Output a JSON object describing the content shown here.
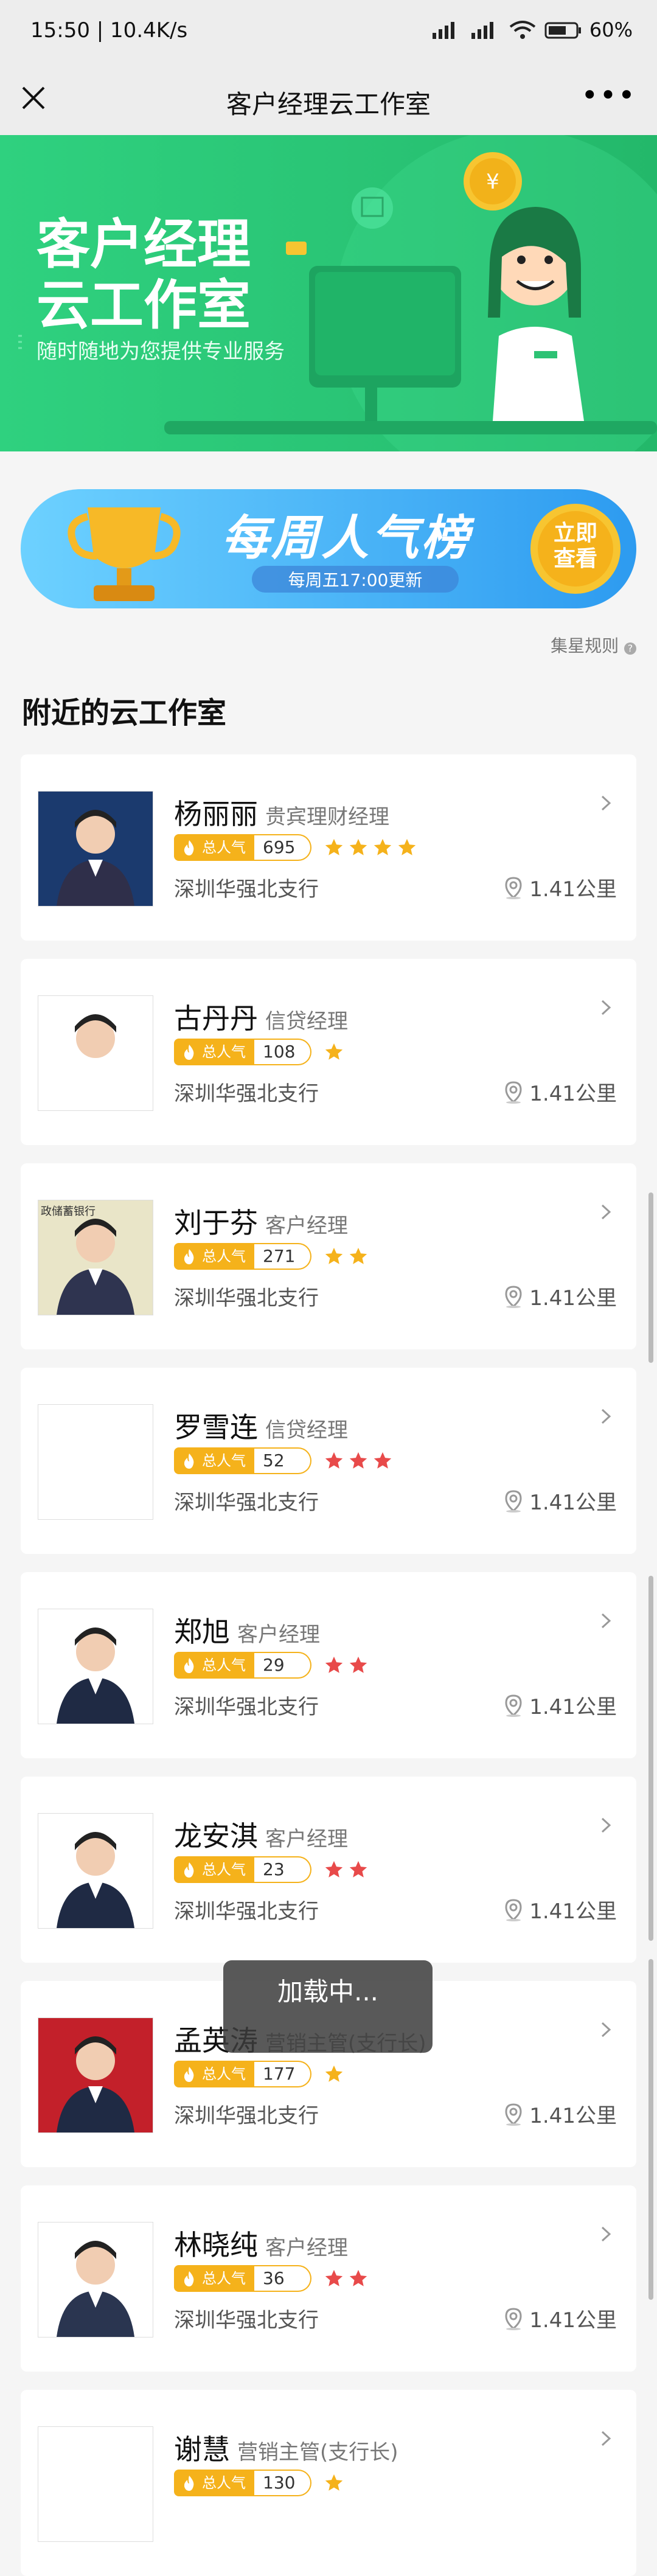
{
  "status": {
    "time": "15:50 | 10.4K/s",
    "battery": "60%"
  },
  "nav": {
    "title": "客户经理云工作室"
  },
  "hero": {
    "line1": "客户经理",
    "line2": "云工作室",
    "subtitle": "随时随地为您提供专业服务",
    "coin": "¥"
  },
  "banner": {
    "title": "每周人气榜",
    "update": "每周五17:00更新",
    "btn_line1": "立即",
    "btn_line2": "查看"
  },
  "rules_link": "集星规则",
  "section_title": "附近的云工作室",
  "popularity_label": "总人气",
  "cards": [
    {
      "name": "杨丽丽",
      "role": "贵宾理财经理",
      "score": "695",
      "stars": 4,
      "star_color": "#f5b21b",
      "branch": "深圳华强北支行",
      "distance": "1.41公里"
    },
    {
      "name": "古丹丹",
      "role": "信贷经理",
      "score": "108",
      "stars": 1,
      "star_color": "#f5b21b",
      "branch": "深圳华强北支行",
      "distance": "1.41公里"
    },
    {
      "name": "刘于芬",
      "role": "客户经理",
      "score": "271",
      "stars": 2,
      "star_color": "#f5b21b",
      "branch": "深圳华强北支行",
      "distance": "1.41公里"
    },
    {
      "name": "罗雪连",
      "role": "信贷经理",
      "score": "52",
      "stars": 3,
      "star_color": "#e84a4a",
      "branch": "深圳华强北支行",
      "distance": "1.41公里"
    },
    {
      "name": "郑旭",
      "role": "客户经理",
      "score": "29",
      "stars": 2,
      "star_color": "#e84a4a",
      "branch": "深圳华强北支行",
      "distance": "1.41公里"
    },
    {
      "name": "龙安淇",
      "role": "客户经理",
      "score": "23",
      "stars": 2,
      "star_color": "#e84a4a",
      "branch": "深圳华强北支行",
      "distance": "1.41公里"
    },
    {
      "name": "孟英涛",
      "role": "营销主管(支行长)",
      "score": "177",
      "stars": 1,
      "star_color": "#f5b21b",
      "branch": "深圳华强北支行",
      "distance": "1.41公里"
    },
    {
      "name": "林晓纯",
      "role": "客户经理",
      "score": "36",
      "stars": 2,
      "star_color": "#e84a4a",
      "branch": "深圳华强北支行",
      "distance": "1.41公里"
    },
    {
      "name": "谢慧",
      "role": "营销主管(支行长)",
      "score": "130",
      "stars": 1,
      "star_color": "#f5b21b",
      "branch": "",
      "distance": ""
    }
  ],
  "photo_bank_text": "政储蓄银行",
  "toast": "加载中..."
}
